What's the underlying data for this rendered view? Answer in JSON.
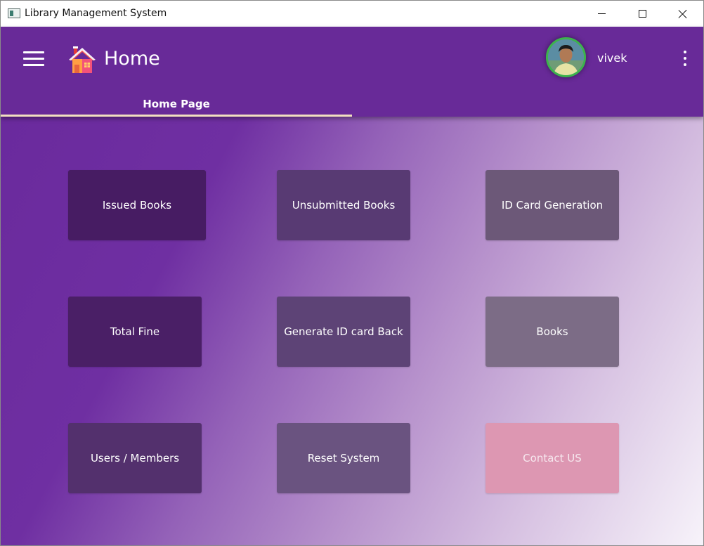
{
  "window": {
    "title": "Library Management System",
    "icon": "app-window-icon",
    "controls": [
      "minimize-icon",
      "maximize-icon",
      "close-icon"
    ]
  },
  "appbar": {
    "menu_icon": "hamburger-menu-icon",
    "home_icon": "house-icon",
    "title": "Home",
    "username": "vivek",
    "more_icon": "more-vertical-icon",
    "background": "#682a98"
  },
  "tabs": [
    {
      "label": "Home Page",
      "selected": true
    }
  ],
  "tiles": [
    {
      "label": "Issued Books"
    },
    {
      "label": "Unsubmitted Books"
    },
    {
      "label": "ID Card Generation"
    },
    {
      "label": "Total Fine"
    },
    {
      "label": "Generate ID card Back"
    },
    {
      "label": "Books"
    },
    {
      "label": "Users / Members"
    },
    {
      "label": "Reset System"
    },
    {
      "label": "Contact US"
    }
  ],
  "colors": {
    "accent": "#682a98",
    "tab_indicator": "#f2dfc0",
    "avatar_ring": "#3cb44b",
    "contact_tile": "#dd97b2"
  }
}
